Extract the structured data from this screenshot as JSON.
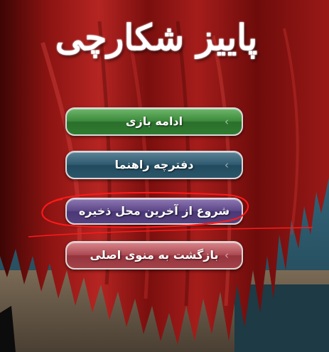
{
  "game": {
    "title": "پاییز شکارچی"
  },
  "menu": {
    "continue_label": "ادامه بازی",
    "guide_label": "دفترچه راهنما",
    "load_last_save_label": "شروع از آخرین محل ذخیره",
    "main_menu_label": "بازگشت به منوی اصلی",
    "chevron_glyph": "‹"
  },
  "colors": {
    "continue_button": "#3c8a3b",
    "guide_button": "#2f5a6f",
    "load_button": "#5c4788",
    "main_menu_button": "#ad4a52",
    "highlight_annotation": "#ff1a1a"
  }
}
